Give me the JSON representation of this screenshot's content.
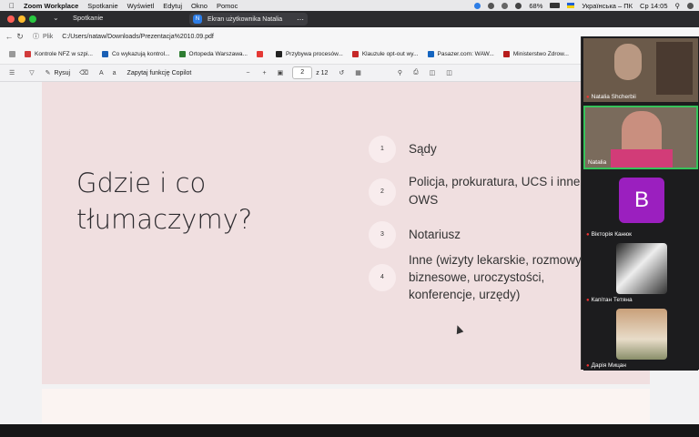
{
  "menubar": {
    "apple": "",
    "items": [
      "Zoom Workplace",
      "Spotkanie",
      "Wyświetl",
      "Edytuj",
      "Okno",
      "Pomoc"
    ],
    "battery": "68%",
    "keyboard": "Українська – ПК",
    "clock": "Ср 14:05"
  },
  "zoom": {
    "title": "Spotkanie",
    "share_label": "Ekran użytkownika Natalia",
    "share_badge": "N"
  },
  "browser": {
    "address_prefix": "Plik",
    "address": "C:/Users/nataw/Downloads/Prezentacja%2010.09.pdf",
    "bookmarks": [
      {
        "label": "Kontrole NFZ w szpi...",
        "color": "#d23b3b"
      },
      {
        "label": "Co wykazują kontrol...",
        "color": "#1a5fb4"
      },
      {
        "label": "Ortopeda Warszawa...",
        "color": "#2e7d32"
      },
      {
        "label": "",
        "color": "#e53935"
      },
      {
        "label": "Przybywa procesów...",
        "color": "#222222"
      },
      {
        "label": "Klauzule opt-out wy...",
        "color": "#c62828"
      },
      {
        "label": "Pasazer.com: WAW...",
        "color": "#1565c0"
      },
      {
        "label": "Ministerstwo Zdrow...",
        "color": "#b71c1c"
      }
    ],
    "pdf_toolbar": {
      "draw": "Rysuj",
      "copilot": "Zapytaj funkcję Copilot",
      "page": "2",
      "of_pages": "z 12"
    }
  },
  "slide": {
    "heading_line1": "Gdzie i co",
    "heading_line2": "tłumaczymy?",
    "items": [
      {
        "num": "1",
        "text": "Sądy"
      },
      {
        "num": "2",
        "text": "Policja, prokuratura, UCS i inne",
        "text2": "OWS"
      },
      {
        "num": "3",
        "text": "Notariusz"
      },
      {
        "num": "4",
        "text": "Inne (wizyty lekarskie, rozmowy",
        "text2": "biznesowe,  uroczystości,",
        "text3": "konferencje, urzędy)"
      }
    ]
  },
  "participants": [
    {
      "name": "Natalia Shcherbii",
      "muted": true
    },
    {
      "name": "Natalia",
      "muted": false
    },
    {
      "name": "Вікторія Канюк",
      "muted": true,
      "initial": "B"
    },
    {
      "name": "Капітан Тетяна",
      "muted": true
    },
    {
      "name": "Дарія Мицан",
      "muted": true
    }
  ]
}
